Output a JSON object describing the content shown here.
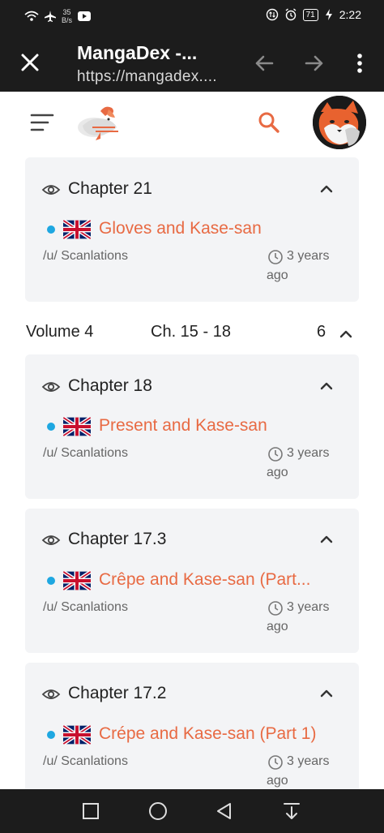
{
  "status_bar": {
    "net_speed_value": "35",
    "net_speed_unit": "B/s",
    "battery": "71",
    "time": "2:22"
  },
  "toolbar": {
    "title": "MangaDex -...",
    "url": "https://mangadex...."
  },
  "volume": {
    "name": "Volume 4",
    "range": "Ch. 15 - 18",
    "count": "6"
  },
  "chapters": [
    {
      "chapter": "Chapter 21",
      "title": "Gloves and Kase-san",
      "group": "/u/ Scanlations",
      "time_line1": "3 years",
      "time_line2": "ago"
    },
    {
      "chapter": "Chapter 18",
      "title": "Present and Kase-san",
      "group": "/u/ Scanlations",
      "time_line1": "3 years",
      "time_line2": "ago"
    },
    {
      "chapter": "Chapter 17.3",
      "title": "Crêpe and Kase-san (Part...",
      "group": "/u/ Scanlations",
      "time_line1": "3 years",
      "time_line2": "ago"
    },
    {
      "chapter": "Chapter 17.2",
      "title": "Crépe and Kase-san (Part 1)",
      "group": "/u/ Scanlations",
      "time_line1": "3 years",
      "time_line2": "ago"
    }
  ],
  "colors": {
    "accent": "#e86a43",
    "unread_dot": "#1ea7e1",
    "card_bg": "#f3f4f6",
    "chrome_bg": "#1c1c1c"
  },
  "icons": {
    "close": "close-icon",
    "back": "arrow-left-icon",
    "forward": "arrow-right-icon",
    "menu": "more-vert-icon",
    "hamburger": "menu-icon",
    "search": "search-icon",
    "eye": "eye-icon",
    "chevron": "chevron-up-icon",
    "flag": "uk-flag-icon",
    "clock": "clock-icon"
  }
}
